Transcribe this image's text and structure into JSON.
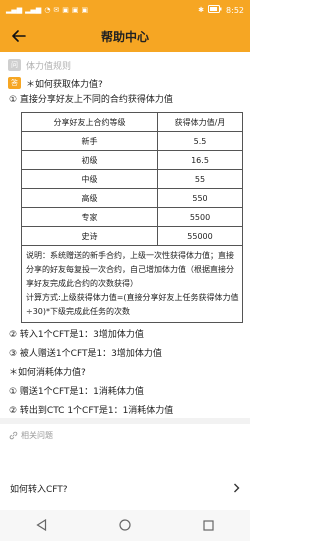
{
  "status_bar": {
    "left_icons": [
      "signal-icon",
      "signal-icon",
      "wifi-icon",
      "message-icon",
      "app-icon",
      "app-icon",
      "app-icon"
    ],
    "time": "8:52",
    "bluetooth": "bluetooth-icon",
    "battery": "battery-icon"
  },
  "header": {
    "title": "帮助中心"
  },
  "question": {
    "badge": "问",
    "text": "体力值规则"
  },
  "answer": {
    "badge": "答",
    "heading": "＊如何获取体力值?"
  },
  "section1": "① 直接分享好友上不同的合约获得体力值",
  "table": {
    "headers": [
      "分享好友上合约等级",
      "获得体力值/月"
    ],
    "rows": [
      [
        "新手",
        "5.5"
      ],
      [
        "初级",
        "16.5"
      ],
      [
        "中级",
        "55"
      ],
      [
        "高级",
        "550"
      ],
      [
        "专家",
        "5500"
      ],
      [
        "史诗",
        "55000"
      ]
    ]
  },
  "note": {
    "p1": "说明：系统赠送的新手合约，上级一次性获得体力值；直接分享的好友每复投一次合约，自己增加体力值（根据直接分享好友完成此合约的次数获得）",
    "p2": "计算方式:上级获得体力值=(直接分享好友上任务获得体力值÷30)*下级完成此任务的次数"
  },
  "section2": "② 转入1个CFT是1：3增加体力值",
  "section3": "③ 被人赠送1个CFT是1：3增加体力值",
  "consume_heading": "＊如何消耗体力值?",
  "consume1": "① 赠送1个CFT是1：1消耗体力值",
  "consume2": "② 转出到CTC 1个CFT是1：1消耗体力值",
  "related": {
    "title": "相关问题",
    "item": "如何转入CFT?"
  }
}
